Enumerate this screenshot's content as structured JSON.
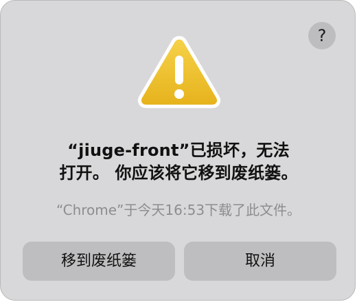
{
  "dialog": {
    "help_label": "?",
    "icon": "warning-triangle-icon",
    "title_line1": "“jiuge-front”已损坏，无法",
    "title_line2": "打开。 你应该将它移到废纸篓。",
    "subtitle": "“Chrome”于今天16:53下载了此文件。",
    "buttons": {
      "move_to_trash": "移到废纸篓",
      "cancel": "取消"
    }
  },
  "colors": {
    "dialog_bg": "#d8d7d9",
    "button_bg": "#bebdbf",
    "warning_fill": "#f0c232",
    "warning_stroke": "#ffffff"
  }
}
